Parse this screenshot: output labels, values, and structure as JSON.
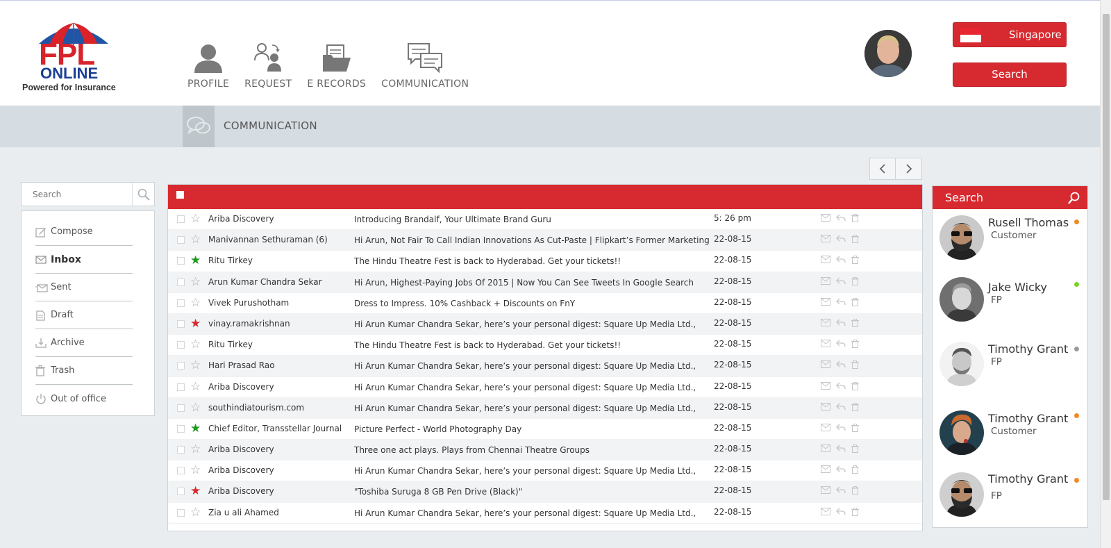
{
  "logo": {
    "brand": "FPL",
    "brand2": "ONLINE",
    "tagline": "Powered for Insurance"
  },
  "nav": [
    {
      "label": "PROFILE",
      "icon": "profile-icon"
    },
    {
      "label": "REQUEST",
      "icon": "request-icon"
    },
    {
      "label": "E RECORDS",
      "icon": "records-icon"
    },
    {
      "label": "COMMUNICATION",
      "icon": "communication-icon"
    }
  ],
  "header": {
    "country": "Singapore",
    "search_label": "Search"
  },
  "subheader": {
    "title": "COMMUNICATION"
  },
  "sidebar": {
    "search_placeholder": "Search",
    "folders": [
      {
        "label": "Compose",
        "icon": "compose-icon"
      },
      {
        "label": "Inbox",
        "icon": "inbox-icon",
        "active": true
      },
      {
        "label": "Sent",
        "icon": "sent-icon"
      },
      {
        "label": "Draft",
        "icon": "draft-icon"
      },
      {
        "label": "Archive",
        "icon": "archive-icon"
      },
      {
        "label": "Trash",
        "icon": "trash-icon"
      },
      {
        "label": "Out of office",
        "icon": "power-icon"
      }
    ]
  },
  "colors": {
    "accent": "#d72a30",
    "star_green": "#1a9a1a",
    "star_red": "#d72a30",
    "star_empty": "#aaaaaa"
  },
  "mails": [
    {
      "sender": "Ariba Discovery",
      "subject": "Introducing Brandalf, Your Ultimate Brand Guru",
      "date": "5: 26 pm",
      "star": "none"
    },
    {
      "sender": "Manivannan Sethuraman (6)",
      "subject": "Hi Arun, Not Fair To Call Indian Innovations As Cut-Paste | Flipkart’s Former Marketing",
      "date": "22-08-15",
      "star": "none"
    },
    {
      "sender": "Ritu Tirkey",
      "subject": "The Hindu Theatre Fest is back to Hyderabad. Get your tickets!!",
      "date": "22-08-15",
      "star": "green"
    },
    {
      "sender": "Arun Kumar Chandra Sekar",
      "subject": "Hi Arun, Highest-Paying Jobs Of 2015 | Now You Can See Tweets In Google Search",
      "date": "22-08-15",
      "star": "none"
    },
    {
      "sender": "Vivek Purushotham",
      "subject": "Dress to Impress. 10% Cashback + Discounts on FnY",
      "date": "22-08-15",
      "star": "none"
    },
    {
      "sender": "vinay.ramakrishnan",
      "subject": "Hi Arun Kumar Chandra Sekar, here’s your personal digest: Square Up Media Ltd.,",
      "date": "22-08-15",
      "star": "red"
    },
    {
      "sender": "Ritu Tirkey",
      "subject": "The Hindu Theatre Fest is back to Hyderabad. Get your tickets!!",
      "date": "22-08-15",
      "star": "none"
    },
    {
      "sender": "Hari Prasad Rao",
      "subject": "Hi Arun Kumar Chandra Sekar, here’s your personal digest: Square Up Media Ltd.,",
      "date": "22-08-15",
      "star": "none"
    },
    {
      "sender": "Ariba Discovery",
      "subject": "Hi Arun Kumar Chandra Sekar, here’s your personal digest: Square Up Media Ltd.,",
      "date": "22-08-15",
      "star": "none"
    },
    {
      "sender": "southindiatourism.com",
      "subject": "Hi Arun Kumar Chandra Sekar, here’s your personal digest: Square Up Media Ltd.,",
      "date": "22-08-15",
      "star": "none"
    },
    {
      "sender": "Chief Editor, Transstellar Journal",
      "subject": "Picture Perfect - World Photography Day",
      "date": "22-08-15",
      "star": "green"
    },
    {
      "sender": "Ariba Discovery",
      "subject": "Three one act plays. Plays from Chennai Theatre Groups",
      "date": "22-08-15",
      "star": "none"
    },
    {
      "sender": "Ariba Discovery",
      "subject": "Hi Arun Kumar Chandra Sekar, here’s your personal digest: Square Up Media Ltd.,",
      "date": "22-08-15",
      "star": "none"
    },
    {
      "sender": "Ariba Discovery",
      "subject": "\"Toshiba Suruga 8 GB Pen Drive (Black)\"",
      "date": "22-08-15",
      "star": "red"
    },
    {
      "sender": "Zia u ali Ahamed",
      "subject": "Hi Arun Kumar Chandra Sekar, here’s your personal digest: Square Up Media Ltd.,",
      "date": "22-08-15",
      "star": "none"
    }
  ],
  "contacts": {
    "title": "Search",
    "items": [
      {
        "name": "Rusell Thomas",
        "role": "Customer",
        "status_color": "#f08a24"
      },
      {
        "name": "Jake Wicky",
        "role": "FP",
        "status_color": "#7ed321"
      },
      {
        "name": "Timothy Grant",
        "role": "FP",
        "status_color": "#9b9b9b"
      },
      {
        "name": "Timothy Grant",
        "role": "Customer",
        "status_color": "#f08a24"
      },
      {
        "name": "Timothy Grant",
        "role": "FP",
        "status_color": "#f08a24"
      }
    ]
  }
}
